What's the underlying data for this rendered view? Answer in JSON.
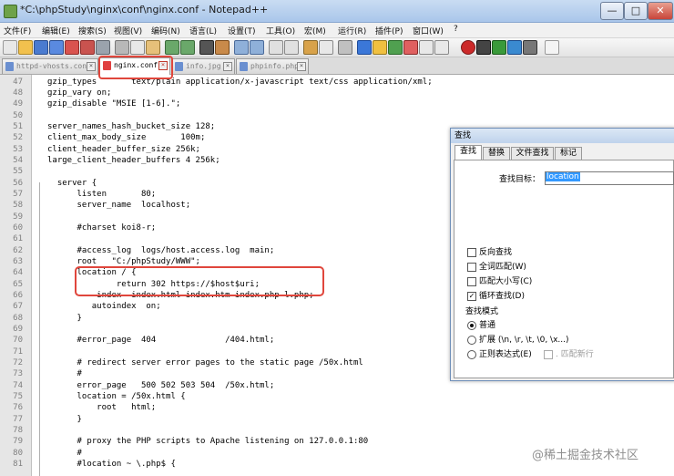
{
  "window": {
    "title": "*C:\\phpStudy\\nginx\\conf\\nginx.conf - Notepad++",
    "min_label": "—",
    "max_label": "□",
    "close_label": "✕"
  },
  "menu": [
    "文件(F)",
    "编辑(E)",
    "搜索(S)",
    "视图(V)",
    "编码(N)",
    "语言(L)",
    "设置(T)",
    "工具(O)",
    "宏(M)",
    "运行(R)",
    "插件(P)",
    "窗口(W)",
    "?"
  ],
  "tabs": [
    {
      "label": "httpd-vhosts.conf",
      "active": false
    },
    {
      "label": "nginx.conf",
      "active": true
    },
    {
      "label": "info.jpg",
      "active": false
    },
    {
      "label": "phpinfo.php",
      "active": false
    }
  ],
  "code_lines": [
    {
      "num": "47",
      "text": "gzip_types       text/plain application/x-javascript text/css application/xml;"
    },
    {
      "num": "48",
      "text": "gzip_vary on;"
    },
    {
      "num": "49",
      "text": "gzip_disable \"MSIE [1-6].\";"
    },
    {
      "num": "50",
      "text": ""
    },
    {
      "num": "51",
      "text": "server_names_hash_bucket_size 128;"
    },
    {
      "num": "52",
      "text": "client_max_body_size       100m;"
    },
    {
      "num": "53",
      "text": "client_header_buffer_size 256k;"
    },
    {
      "num": "54",
      "text": "large_client_header_buffers 4 256k;"
    },
    {
      "num": "55",
      "text": ""
    },
    {
      "num": "56",
      "text": "  server {"
    },
    {
      "num": "57",
      "text": "      listen       80;"
    },
    {
      "num": "58",
      "text": "      server_name  localhost;"
    },
    {
      "num": "59",
      "text": ""
    },
    {
      "num": "60",
      "text": "      #charset koi8-r;"
    },
    {
      "num": "61",
      "text": ""
    },
    {
      "num": "62",
      "text": "      #access_log  logs/host.access.log  main;"
    },
    {
      "num": "63",
      "text": "      root   \"C:/phpStudy/WWW\";"
    },
    {
      "num": "64",
      "text": "      location / {"
    },
    {
      "num": "65",
      "text": "              return 302 https://$host$uri;"
    },
    {
      "num": "66",
      "text": "          index  index.html index.htm index.php l.php;"
    },
    {
      "num": "67",
      "text": "         autoindex  on;"
    },
    {
      "num": "68",
      "text": "      }"
    },
    {
      "num": "69",
      "text": ""
    },
    {
      "num": "70",
      "text": "      #error_page  404              /404.html;"
    },
    {
      "num": "71",
      "text": ""
    },
    {
      "num": "72",
      "text": "      # redirect server error pages to the static page /50x.html"
    },
    {
      "num": "73",
      "text": "      #"
    },
    {
      "num": "74",
      "text": "      error_page   500 502 503 504  /50x.html;"
    },
    {
      "num": "75",
      "text": "      location = /50x.html {"
    },
    {
      "num": "76",
      "text": "          root   html;"
    },
    {
      "num": "77",
      "text": "      }"
    },
    {
      "num": "78",
      "text": ""
    },
    {
      "num": "79",
      "text": "      # proxy the PHP scripts to Apache listening on 127.0.0.1:80"
    },
    {
      "num": "80",
      "text": "      #"
    },
    {
      "num": "81",
      "text": "      #location ~ \\.php$ {"
    }
  ],
  "find_dialog": {
    "title": "查找",
    "tabs": [
      "查找",
      "替换",
      "文件查找",
      "标记"
    ],
    "find_label": "查找目标：",
    "find_value": "location",
    "options": [
      {
        "label": "反向查找",
        "checked": false
      },
      {
        "label": "全词匹配(W)",
        "checked": false
      },
      {
        "label": "匹配大小写(C)",
        "checked": false
      },
      {
        "label": "循环查找(D)",
        "checked": true
      }
    ],
    "mode_title": "查找模式",
    "modes": [
      {
        "label": "普通",
        "selected": true
      },
      {
        "label": "扩展 (\\n, \\r, \\t, \\0, \\x...)",
        "selected": false
      },
      {
        "label": "正则表达式(E)",
        "selected": false
      }
    ],
    "newline_option": ". 匹配新行",
    "check_mark": "✓"
  },
  "watermark": "@稀土掘金技术社区"
}
